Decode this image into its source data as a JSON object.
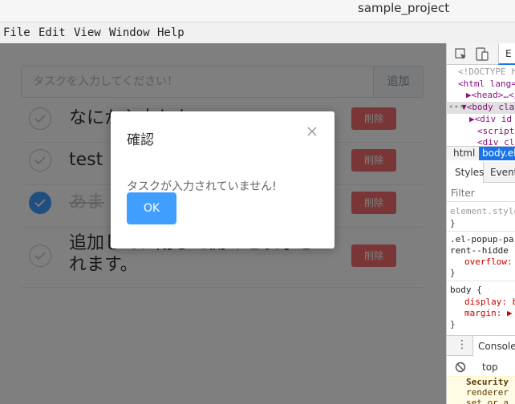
{
  "window": {
    "title": "sample_project"
  },
  "menu": [
    "File",
    "Edit",
    "View",
    "Window",
    "Help"
  ],
  "app": {
    "input_placeholder": "タスクを入力してください！",
    "add_label": "追加",
    "delete_label": "削除",
    "tasks": [
      {
        "text": "なにか入力した",
        "done": false
      },
      {
        "text": "test",
        "done": false
      },
      {
        "text": "あま",
        "done": true
      },
      {
        "text": "追加して、閉じて開くと表示されます。",
        "done": false
      }
    ]
  },
  "dialog": {
    "title": "確認",
    "message": "タスクが入力されていません!",
    "ok_label": "OK"
  },
  "devtools": {
    "tab_elements": "E",
    "dom_lines": [
      "<!DOCTYPE h",
      "<html lang=",
      "▶<head>…</",
      "▼<body cla",
      "▶<div id",
      "<script",
      "<div cl"
    ],
    "crumbs": [
      "html",
      "body.el-"
    ],
    "style_tabs": [
      "Styles",
      "Event"
    ],
    "filter_placeholder": "Filter",
    "rules": [
      {
        "selector": "element.style",
        "lines": []
      },
      {
        "selector": ".el-popup-parent--hidde",
        "lines": [
          "overflow: h"
        ]
      },
      {
        "selector": "body {",
        "lines": [
          "display: b",
          "margin: ▶ 8"
        ]
      }
    ],
    "console_label": "Console",
    "context": "top",
    "warning_lines": [
      "Security",
      "renderer",
      "set or a"
    ]
  },
  "colors": {
    "primary": "#409eff",
    "danger": "#f56c6c",
    "overlay": "rgba(0,0,0,0.5)"
  }
}
